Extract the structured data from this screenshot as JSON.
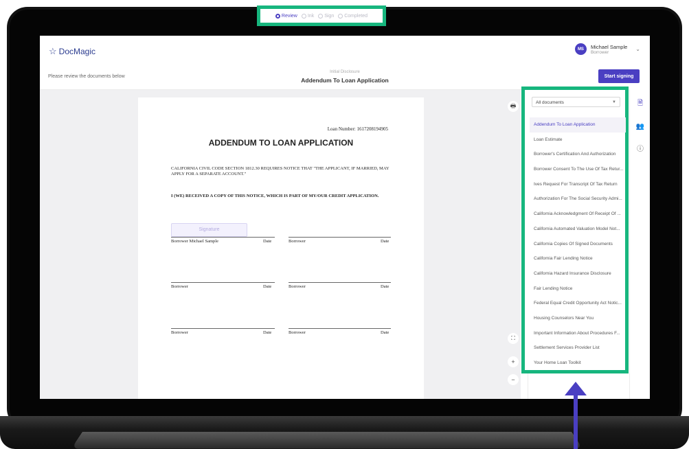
{
  "brand": {
    "name": "DocMagic",
    "logo_icon": "star-outline-icon"
  },
  "steps": [
    {
      "label": "Review",
      "active": true
    },
    {
      "label": "Ink",
      "active": false
    },
    {
      "label": "Sign",
      "active": false
    },
    {
      "label": "Completed",
      "active": false
    }
  ],
  "user": {
    "initials": "MS",
    "name": "Michael Sample",
    "role": "Borrower"
  },
  "subheader": {
    "message": "Please review the documents below",
    "doc_category": "Initial Disclosure",
    "doc_title": "Addendum To Loan Application",
    "start_label": "Start signing"
  },
  "document": {
    "loan_number": "Loan Number: 1617208194905",
    "title": "ADDENDUM TO LOAN APPLICATION",
    "notice": "CALIFORNIA CIVIL CODE SECTION 1812.30 REQUIRES NOTICE THAT \"THE APPLICANT, IF MARRIED, MAY APPLY FOR A SEPARATE ACCOUNT.\"",
    "receipt": "I (WE) RECEIVED A COPY OF THIS NOTICE, WHICH IS PART OF MY/OUR CREDIT APPLICATION.",
    "signature_label": "Signature",
    "rows": [
      {
        "left": "Borrower Michael Sample",
        "left_date": "Date",
        "right": "Borrower",
        "right_date": "Date"
      },
      {
        "left": "Borrower",
        "left_date": "Date",
        "right": "Borrower",
        "right_date": "Date"
      },
      {
        "left": "Borrower",
        "left_date": "Date",
        "right": "Borrower",
        "right_date": "Date"
      }
    ]
  },
  "tools": {
    "print": "printer-icon",
    "fullscreen": "fullscreen-icon",
    "zoom_in": "+",
    "zoom_out": "−"
  },
  "panel": {
    "filter": "All documents",
    "documents": [
      "Addendum To Loan Application",
      "Loan Estimate",
      "Borrower's Certification And Authorization",
      "Borrower Consent To The Use Of Tax Retur...",
      "Ives Request For Transcript Of Tax Return",
      "Authorization For The Social Security Admi...",
      "California Acknowledgment Of Receipt Of ...",
      "California Automated Valuation Model Not...",
      "California Copies Of Signed Documents",
      "California Fair Lending Notice",
      "California Hazard Insurance Disclosure",
      "Fair Lending Notice",
      "Federal Equal Credit Opportunity Act Notic...",
      "Housing Counselors Near You",
      "Important Information About Procedures F...",
      "Settlement Services Provider List",
      "Your Home Loan Toolkit"
    ]
  },
  "colors": {
    "accent": "#4a3fc2",
    "highlight": "#17b67e"
  }
}
